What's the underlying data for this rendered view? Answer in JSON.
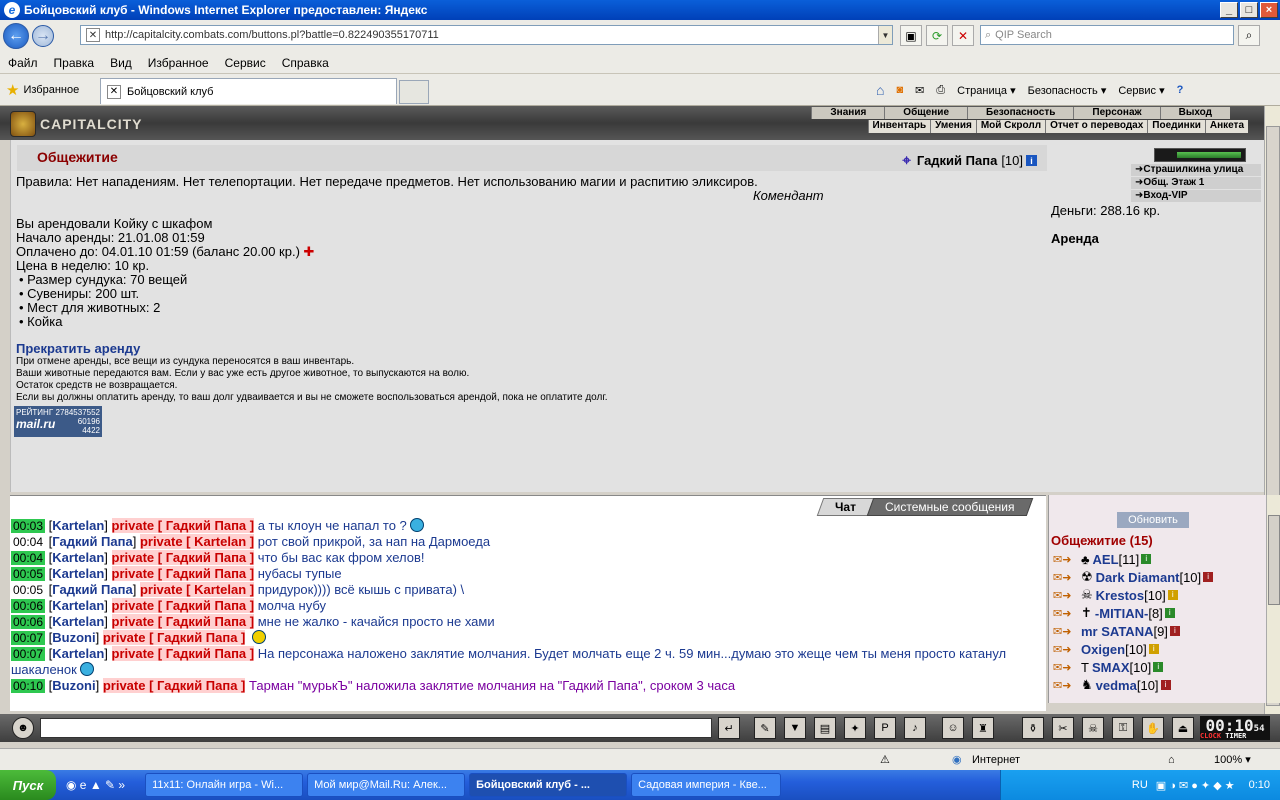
{
  "window": {
    "title": "Бойцовский клуб - Windows Internet Explorer предоставлен: Яндекс",
    "url": "http://capitalcity.combats.com/buttons.pl?battle=0.822490355170711",
    "search_placeholder": "QIP Search"
  },
  "menu": [
    "Файл",
    "Правка",
    "Вид",
    "Избранное",
    "Сервис",
    "Справка"
  ],
  "favbar": {
    "favorites": "Избранное",
    "tab_title": "Бойцовский клуб"
  },
  "commandbar": [
    "Страница ▾",
    "Безопасность ▾",
    "Сервис ▾"
  ],
  "game_nav": {
    "top": [
      "Знания",
      "Общение",
      "Безопасность",
      "Персонаж",
      "Выход"
    ],
    "sub": [
      "Инвентарь",
      "Умения",
      "Мой Скролл",
      "Отчет о переводах",
      "Поединки",
      "Анкета"
    ],
    "logo": "CAPITALCITY"
  },
  "page": {
    "title": "Общежитие",
    "player": "Гадкий Папа",
    "player_level": "[10]",
    "rules": "Правила: Нет нападениям. Нет телепортации. Нет передаче предметов. Нет использованию магии и распитию эликсиров.",
    "rules_author": "Комендант",
    "rent_info": [
      "Вы арендовали Койку с шкафом",
      "Начало аренды: 21.01.08 01:59",
      "Оплачено до: 04.01.10 01:59 (баланс 20.00 кр.)",
      "Цена в неделю: 10 кр."
    ],
    "features": [
      "• Размер сундука: 70 вещей",
      "• Сувениры: 200 шт.",
      "• Мест для животных: 2",
      "• Койка"
    ],
    "cancel_link": "Прекратить аренду",
    "cancel_notes": [
      "При отмене аренды, все вещи из сундука переносятся в ваш инвентарь.",
      "Ваши животные передаются вам. Если у вас уже есть другое животное, то выпускаются на волю.",
      "Остаток средств не возвращается.",
      "Если вы должны оплатить аренду, то ваш долг удваивается и вы не сможете воспользоваться арендой, пока не оплатите долг."
    ],
    "rating": {
      "label": "РЕЙТИНГ",
      "value": "2784537552",
      "brand": "mail.ru",
      "n1": "60196",
      "n2": "4422"
    }
  },
  "right_panel": {
    "locations": [
      "Страшилкина улица",
      "Общ. Этаж 1",
      "Вход-VIP"
    ],
    "money": "Деньги: 288.16 кр.",
    "section": "Аренда"
  },
  "chat": {
    "tabs": [
      "Чат",
      "Системные сообщения"
    ],
    "messages": [
      {
        "time": "00:03",
        "hl": true,
        "nick": "Kartelan",
        "priv": "private [ Гадкий Папа ]",
        "text": "а ты клоун че напал то ?",
        "smile": "blue"
      },
      {
        "time": "00:04",
        "hl": false,
        "nick": "Гадкий Папа",
        "priv": "private [ Kartelan ]",
        "text": "рот свой прикрой, за нап на Дармоеда",
        "smile": ""
      },
      {
        "time": "00:04",
        "hl": true,
        "nick": "Kartelan",
        "priv": "private [ Гадкий Папа ]",
        "text": "что бы вас как фром хелов!",
        "smile": ""
      },
      {
        "time": "00:05",
        "hl": true,
        "nick": "Kartelan",
        "priv": "private [ Гадкий Папа ]",
        "text": "нубасы тупые",
        "smile": ""
      },
      {
        "time": "00:05",
        "hl": false,
        "nick": "Гадкий Папа",
        "priv": "private [ Kartelan ]",
        "text": "придурок)))) всё кышь с привата) \\",
        "smile": ""
      },
      {
        "time": "00:06",
        "hl": true,
        "nick": "Kartelan",
        "priv": "private [ Гадкий Папа ]",
        "text": "молча нубу",
        "smile": ""
      },
      {
        "time": "00:06",
        "hl": true,
        "nick": "Kartelan",
        "priv": "private [ Гадкий Папа ]",
        "text": "мне не жалко - качайся просто не хами",
        "smile": ""
      },
      {
        "time": "00:07",
        "hl": true,
        "nick": "Buzoni",
        "priv": "private [ Гадкий Папа ]",
        "text": "",
        "smile": "yellow"
      },
      {
        "time": "00:07",
        "hl": true,
        "nick": "Kartelan",
        "priv": "private [ Гадкий Папа ]",
        "text": "На персонажа наложено заклятие молчания. Будет молчать еще 2 ч. 59 мин...думаю это жеще чем ты меня просто катанул шакаленок",
        "smile": "blue"
      },
      {
        "time": "00:10",
        "hl": true,
        "nick": "Buzoni",
        "priv": "private [ Гадкий Папа ]",
        "text": "Тарман \"мурькЪ\" наложила заклятие молчания на \"Гадкий Папа\", сроком 3 часа",
        "smile": "",
        "sys": true
      }
    ]
  },
  "online": {
    "refresh": "Обновить",
    "header": "Общежитие (15)",
    "users": [
      {
        "name": "AEL",
        "level": "[11]"
      },
      {
        "name": "Dark Diamant",
        "level": "[10]"
      },
      {
        "name": "Krestos",
        "level": "[10]"
      },
      {
        "name": "-MITIAN-",
        "level": "[8]"
      },
      {
        "name": "mr SATANA",
        "level": "[9]"
      },
      {
        "name": "Oxigen",
        "level": "[10]"
      },
      {
        "name": "SMAX",
        "level": "[10]"
      },
      {
        "name": "vedma",
        "level": "[10]"
      }
    ]
  },
  "clock": {
    "time": "00:10",
    "sec": "54",
    "label_clock": "CLOCK",
    "label_timer": "TIMER"
  },
  "status": {
    "zone": "Интернет",
    "zoom": "100% ▾"
  },
  "taskbar": {
    "start": "Пуск",
    "items": [
      "11x11: Онлайн игра - Wi...",
      "Мой мир@Mail.Ru: Алек...",
      "Бойцовский клуб - ...",
      "Садовая империя - Кве..."
    ],
    "active": 2,
    "lang": "RU",
    "time": "0:10"
  }
}
